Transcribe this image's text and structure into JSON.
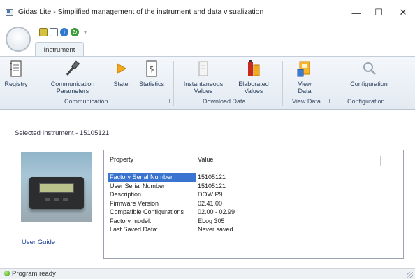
{
  "window": {
    "title": "Gidas Lite - Simplified management of the instrument and data visualization",
    "controls": {
      "minimize": "—",
      "maximize": "☐",
      "close": "✕"
    }
  },
  "ribbon": {
    "tab": "Instrument",
    "buttons": {
      "registry": "Registry",
      "communication_parameters_1": "Communication",
      "communication_parameters_2": "Parameters",
      "state": "State",
      "statistics": "Statistics",
      "instantaneous_values_1": "Instantaneous",
      "instantaneous_values_2": "Values",
      "elaborated_values_1": "Elaborated",
      "elaborated_values_2": "Values",
      "view_data_1": "View",
      "view_data_2": "Data",
      "configuration": "Configuration"
    },
    "groups": {
      "communication": "Communication",
      "download_data": "Download Data",
      "view_data": "View Data",
      "configuration": "Configuration"
    }
  },
  "instrument": {
    "selected_label": "Selected Instrument - 15105121",
    "user_guide": "User Guide",
    "properties": {
      "header_property": "Property",
      "header_value": "Value",
      "rows": [
        {
          "property": "Factory Serial Number",
          "value": "15105121"
        },
        {
          "property": "User Serial Number",
          "value": "15105121"
        },
        {
          "property": "Description",
          "value": "DOW P9"
        },
        {
          "property": "Firmware Version",
          "value": "02.41.00"
        },
        {
          "property": "Compatible Configurations",
          "value": "02.00 - 02.99"
        },
        {
          "property": "Factory model:",
          "value": "ELog 305"
        },
        {
          "property": "Last Saved Data:",
          "value": "Never saved"
        }
      ]
    }
  },
  "status": {
    "text": "Program ready",
    "color": "#3c9a1c"
  },
  "colors": {
    "selection": "#3a74d0",
    "ribbon_text": "#2a3f5c",
    "link": "#1c3f9a"
  }
}
